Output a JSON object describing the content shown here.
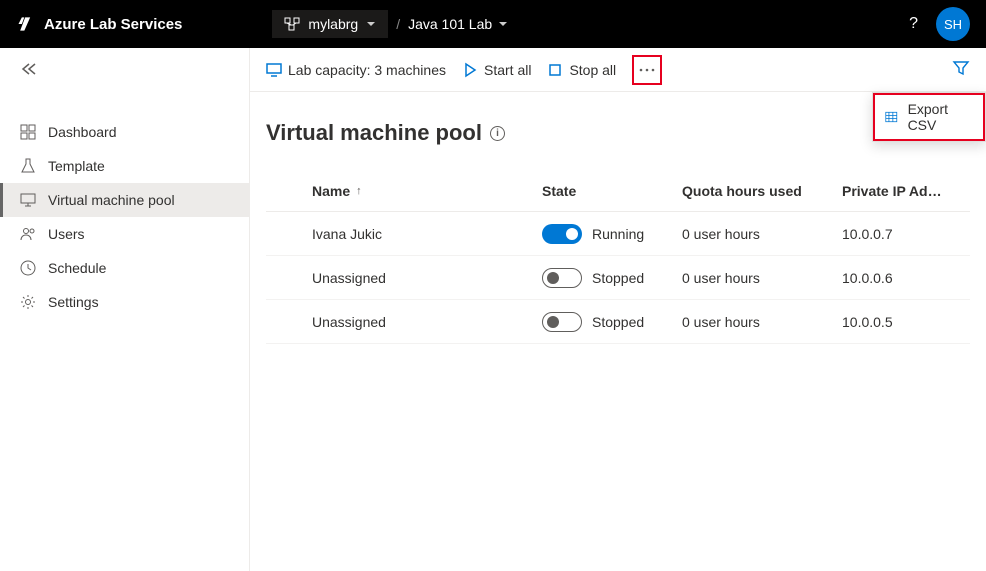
{
  "header": {
    "brand": "Azure Lab Services",
    "resource_group": "mylabrg",
    "lab_name": "Java 101 Lab",
    "avatar_initials": "SH"
  },
  "sidebar": {
    "items": [
      {
        "label": "Dashboard"
      },
      {
        "label": "Template"
      },
      {
        "label": "Virtual machine pool"
      },
      {
        "label": "Users"
      },
      {
        "label": "Schedule"
      },
      {
        "label": "Settings"
      }
    ]
  },
  "toolbar": {
    "capacity": "Lab capacity: 3 machines",
    "start_all": "Start all",
    "stop_all": "Stop all",
    "export_csv": "Export CSV"
  },
  "page": {
    "title": "Virtual machine pool"
  },
  "table": {
    "columns": {
      "name": "Name",
      "state": "State",
      "quota": "Quota hours used",
      "ip": "Private IP Ad…"
    },
    "rows": [
      {
        "name": "Ivana Jukic",
        "state": "Running",
        "running": true,
        "quota": "0 user hours",
        "ip": "10.0.0.7"
      },
      {
        "name": "Unassigned",
        "state": "Stopped",
        "running": false,
        "quota": "0 user hours",
        "ip": "10.0.0.6"
      },
      {
        "name": "Unassigned",
        "state": "Stopped",
        "running": false,
        "quota": "0 user hours",
        "ip": "10.0.0.5"
      }
    ]
  }
}
